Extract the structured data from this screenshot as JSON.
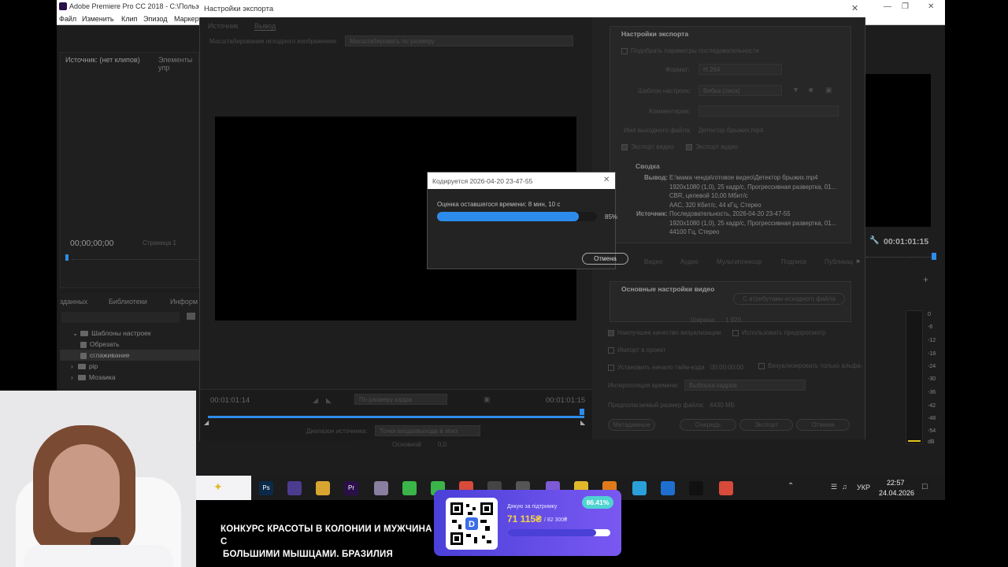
{
  "premiere": {
    "title": "Adobe Premiere Pro CC 2018 - C:\\Пользов",
    "menu": [
      "Файл",
      "Изменить",
      "Клип",
      "Эпизод",
      "Маркер"
    ],
    "source_tab": "Источник: (нет клипов)",
    "elements_tab": "Элементы упр",
    "timecode_left": "00;00;00;00",
    "page_label": "Страница 1",
    "project_tabs": [
      "зданных",
      "Библиотеки",
      "Информ"
    ],
    "tree": [
      {
        "label": "Шаблоны настроек",
        "kind": "folder",
        "indent": 0
      },
      {
        "label": "Обрезать",
        "kind": "preset",
        "indent": 1
      },
      {
        "label": "сглаживание",
        "kind": "preset",
        "indent": 1,
        "selected": true
      },
      {
        "label": "pip",
        "kind": "folder",
        "indent": 1
      },
      {
        "label": "Мозаика",
        "kind": "folder",
        "indent": 1
      }
    ],
    "program_timecode": "00:01:01:15",
    "meter_labels": [
      "0",
      "-6",
      "-12",
      "-18",
      "-24",
      "-30",
      "-36",
      "-42",
      "-48",
      "-54",
      "dB"
    ]
  },
  "export_dialog": {
    "title": "Настройки экспорта",
    "tabs": [
      "Источник",
      "Вывод"
    ],
    "scale_label": "Масштабирование исходного изображения:",
    "scale_value": "Масштабировать по размеру",
    "in_timecode": "00:01:01:14",
    "out_timecode": "00:01:01:15",
    "fit_label": "По размеру кадра",
    "source_range_label": "Диапазон источника:",
    "source_range_value": "Точки входа/выхода в эпиз",
    "settings": {
      "header": "Настройки экспорта",
      "match_sequence": "Подобрать параметры последовательности",
      "format_label": "Формат:",
      "format_value": "H.264",
      "preset_label": "Шаблон настроек:",
      "preset_value": "Вебка (лиск)",
      "comments_label": "Комментарии:",
      "output_name_label": "Имя выходного файла:",
      "output_name_value": "Детектор брыжих.mp4",
      "export_video": "Экспорт видео",
      "export_audio": "Экспорт аудио",
      "summary_header": "Сводка",
      "output_label": "Вывод:",
      "output_lines": [
        "E:\\мама ченда\\готовое видео\\Детектор брыжих.mp4",
        "1920x1080 (1,0), 25 кадр/с, Прогрессивная развертка, 01...",
        "CBR, целевой 10,00 Мбит/с",
        "AAC, 320 Кбит/с, 44 кГц, Стерео"
      ],
      "source_label": "Источник:",
      "source_lines": [
        "Последовательность, 2026-04-20 23-47-55",
        "1920x1080 (1,0), 25 кадр/с, Прогрессивная развертка, 01...",
        "44100 Гц, Стерео"
      ],
      "sub_tabs": [
        "Видео",
        "Аудио",
        "Мультиплексор",
        "Подписи",
        "Публикац"
      ],
      "basic_video_header": "Основные настройки видео",
      "match_source_btn": "С атрибутами исходного файла",
      "width_label": "Ширина:",
      "width_value": "1 920",
      "max_quality": "Наилучшее качество визуализации",
      "use_previews": "Использовать предпросмотр",
      "import_project": "Импорт в проект",
      "set_timecode": "Установить начало тайм-кода",
      "timecode_value": "00:00:00:00",
      "alpha_only": "Визуализировать только альфа-",
      "interp_label": "Интерполяция времени:",
      "interp_value": "Выборка кадров",
      "filesize_label": "Предполагаемый размер файла:",
      "filesize_value": "4430 МБ",
      "buttons": [
        "Метаданные",
        "Очередь",
        "Экспорт",
        "Отмена"
      ]
    }
  },
  "encoding": {
    "title": "Кодируется 2026-04-20 23-47-55",
    "remaining": "Оценка оставшегося времени: 8 мин, 10 с",
    "percent_label": "85%",
    "progress": 0.85,
    "cancel": "Отмена"
  },
  "taskbar": {
    "apps": [
      {
        "name": "photoshop-icon",
        "label": "Ps",
        "color": "#0b2a4a"
      },
      {
        "name": "app-icon",
        "label": "",
        "color": "#4b3c8f"
      },
      {
        "name": "folder-icon",
        "label": "",
        "color": "#d9a531"
      },
      {
        "name": "premiere-icon",
        "label": "Pr",
        "color": "#2a0f4a"
      },
      {
        "name": "paint-icon",
        "label": "",
        "color": "#8a7fa0"
      },
      {
        "name": "android-icon",
        "label": "",
        "color": "#3bb54a"
      },
      {
        "name": "chat-icon",
        "label": "",
        "color": "#3bb54a"
      },
      {
        "name": "chrome-icon",
        "label": "",
        "color": "#d84a3a"
      },
      {
        "name": "obs-icon",
        "label": "",
        "color": "#444"
      },
      {
        "name": "steam-icon",
        "label": "",
        "color": "#555"
      },
      {
        "name": "viber-icon",
        "label": "",
        "color": "#7d5bd6"
      },
      {
        "name": "emoji-icon",
        "label": "",
        "color": "#e0b82a"
      },
      {
        "name": "vlc-icon",
        "label": "",
        "color": "#e07a1a"
      },
      {
        "name": "telegram-icon",
        "label": "",
        "color": "#2aa0d8"
      },
      {
        "name": "dots-icon",
        "label": "",
        "color": "#1e6fd0"
      },
      {
        "name": "terminal-icon",
        "label": "",
        "color": "#111"
      },
      {
        "name": "chrome-icon",
        "label": "",
        "color": "#d84a3a"
      }
    ],
    "lang": "УКР",
    "time": "22:57",
    "date": "24.04.2026"
  },
  "donate": {
    "label": "Дякую за підтримку",
    "amount": "71 115₴",
    "goal": "/ 82 300₴",
    "percent_label": "86.41%",
    "progress": 0.8641
  },
  "caption": {
    "line1": "КОНКУРС КРАСОТЫ В КОЛОНИИ И МУЖЧИНА С",
    "line2": "БОЛЬШИМИ МЫШЦАМИ. БРАЗИЛИЯ"
  }
}
